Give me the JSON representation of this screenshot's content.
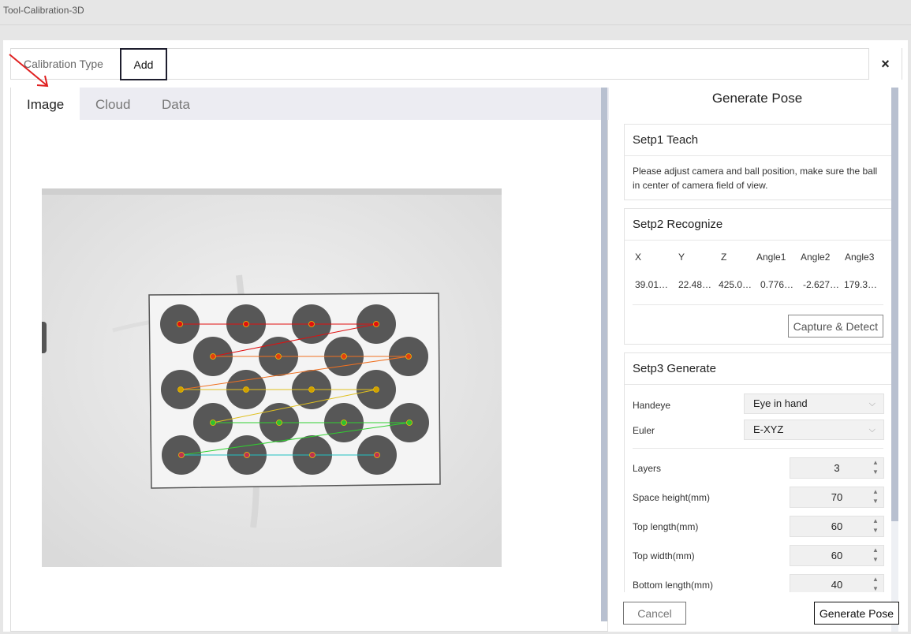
{
  "window": {
    "title": "Tool-Calibration-3D"
  },
  "topbar": {
    "calibration_type_label": "Calibration Type",
    "add_label": "Add",
    "close_glyph": "×"
  },
  "tabs": [
    {
      "label": "Image",
      "active": true
    },
    {
      "label": "Cloud",
      "active": false
    },
    {
      "label": "Data",
      "active": false
    }
  ],
  "right": {
    "title": "Generate Pose",
    "step1": {
      "title": "Setp1 Teach",
      "text": "Please adjust camera and ball position, make sure the ball in center of camera field of view."
    },
    "step2": {
      "title": "Setp2 Recognize",
      "headers": [
        "X",
        "Y",
        "Z",
        "Angle1",
        "Angle2",
        "Angle3"
      ],
      "values": [
        "39.01…",
        "22.48…",
        "425.0…",
        "0.776…",
        "-2.627…",
        "179.3…"
      ],
      "capture_label": "Capture & Detect"
    },
    "step3": {
      "title": "Setp3 Generate",
      "handeye_label": "Handeye",
      "handeye_value": "Eye in hand",
      "euler_label": "Euler",
      "euler_value": "E-XYZ",
      "params": [
        {
          "label": "Layers",
          "value": "3"
        },
        {
          "label": "Space height(mm)",
          "value": "70"
        },
        {
          "label": "Top length(mm)",
          "value": "60"
        },
        {
          "label": "Top width(mm)",
          "value": "60"
        },
        {
          "label": "Bottom length(mm)",
          "value": "40"
        }
      ]
    }
  },
  "footer": {
    "cancel_label": "Cancel",
    "generate_label": "Generate Pose"
  },
  "colors": {
    "accent_border": "#1e1e2e",
    "scrollbar": "#b8c0d0",
    "arrow": "#e02020"
  }
}
